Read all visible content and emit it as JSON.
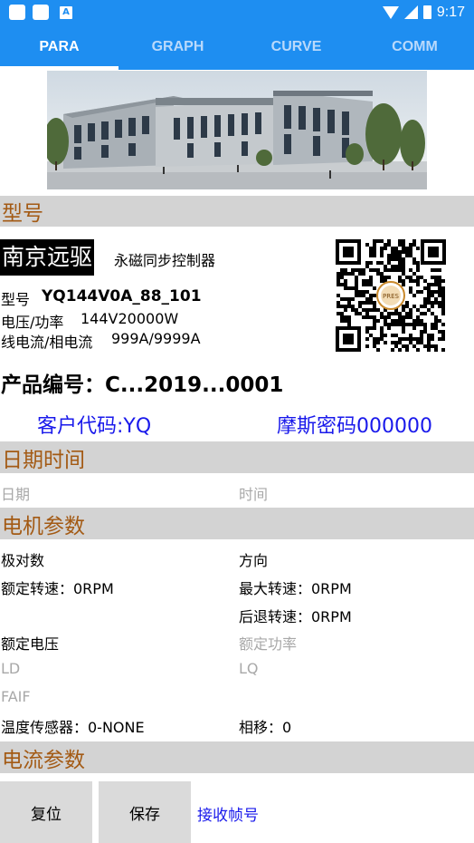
{
  "status_bar": {
    "time": "9:17",
    "notif_letter": "A"
  },
  "tabs": [
    {
      "label": "PARA",
      "active": true
    },
    {
      "label": "GRAPH",
      "active": false
    },
    {
      "label": "CURVE",
      "active": false
    },
    {
      "label": "COMM",
      "active": false
    }
  ],
  "sections": {
    "model": "型号",
    "datetime": "日期时间",
    "motor": "电机参数",
    "current": "电流参数"
  },
  "product": {
    "company": "南京远驱",
    "product_type": "永磁同步控制器",
    "model_label": "型号",
    "model_value": "YQ144V0A_88_101",
    "voltage_label": "电压/功率",
    "voltage_value": "144V20000W",
    "current_label": "线电流/相电流",
    "current_value": "999A/9999A",
    "qr_logo_text": "PRES",
    "product_no": "产品编号：C...2019...0001",
    "customer_code": "客户代码:YQ",
    "morse_code": "摩斯密码000000"
  },
  "datetime": {
    "date_placeholder": "日期",
    "time_placeholder": "时间"
  },
  "motor": {
    "pole_pairs": "极对数",
    "direction": "方向",
    "rated_speed": "额定转速：0RPM",
    "max_speed": "最大转速：0RPM",
    "reverse_speed": "后退转速：0RPM",
    "rated_voltage": "额定电压",
    "rated_power": "额定功率",
    "ld": "LD",
    "lq": "LQ",
    "faif": "FAIF",
    "temp_sensor": "温度传感器：0-NONE",
    "phase_shift": "相移：0"
  },
  "actions": {
    "reset": "复位",
    "save": "保存",
    "receive_frame": "接收帧号"
  }
}
